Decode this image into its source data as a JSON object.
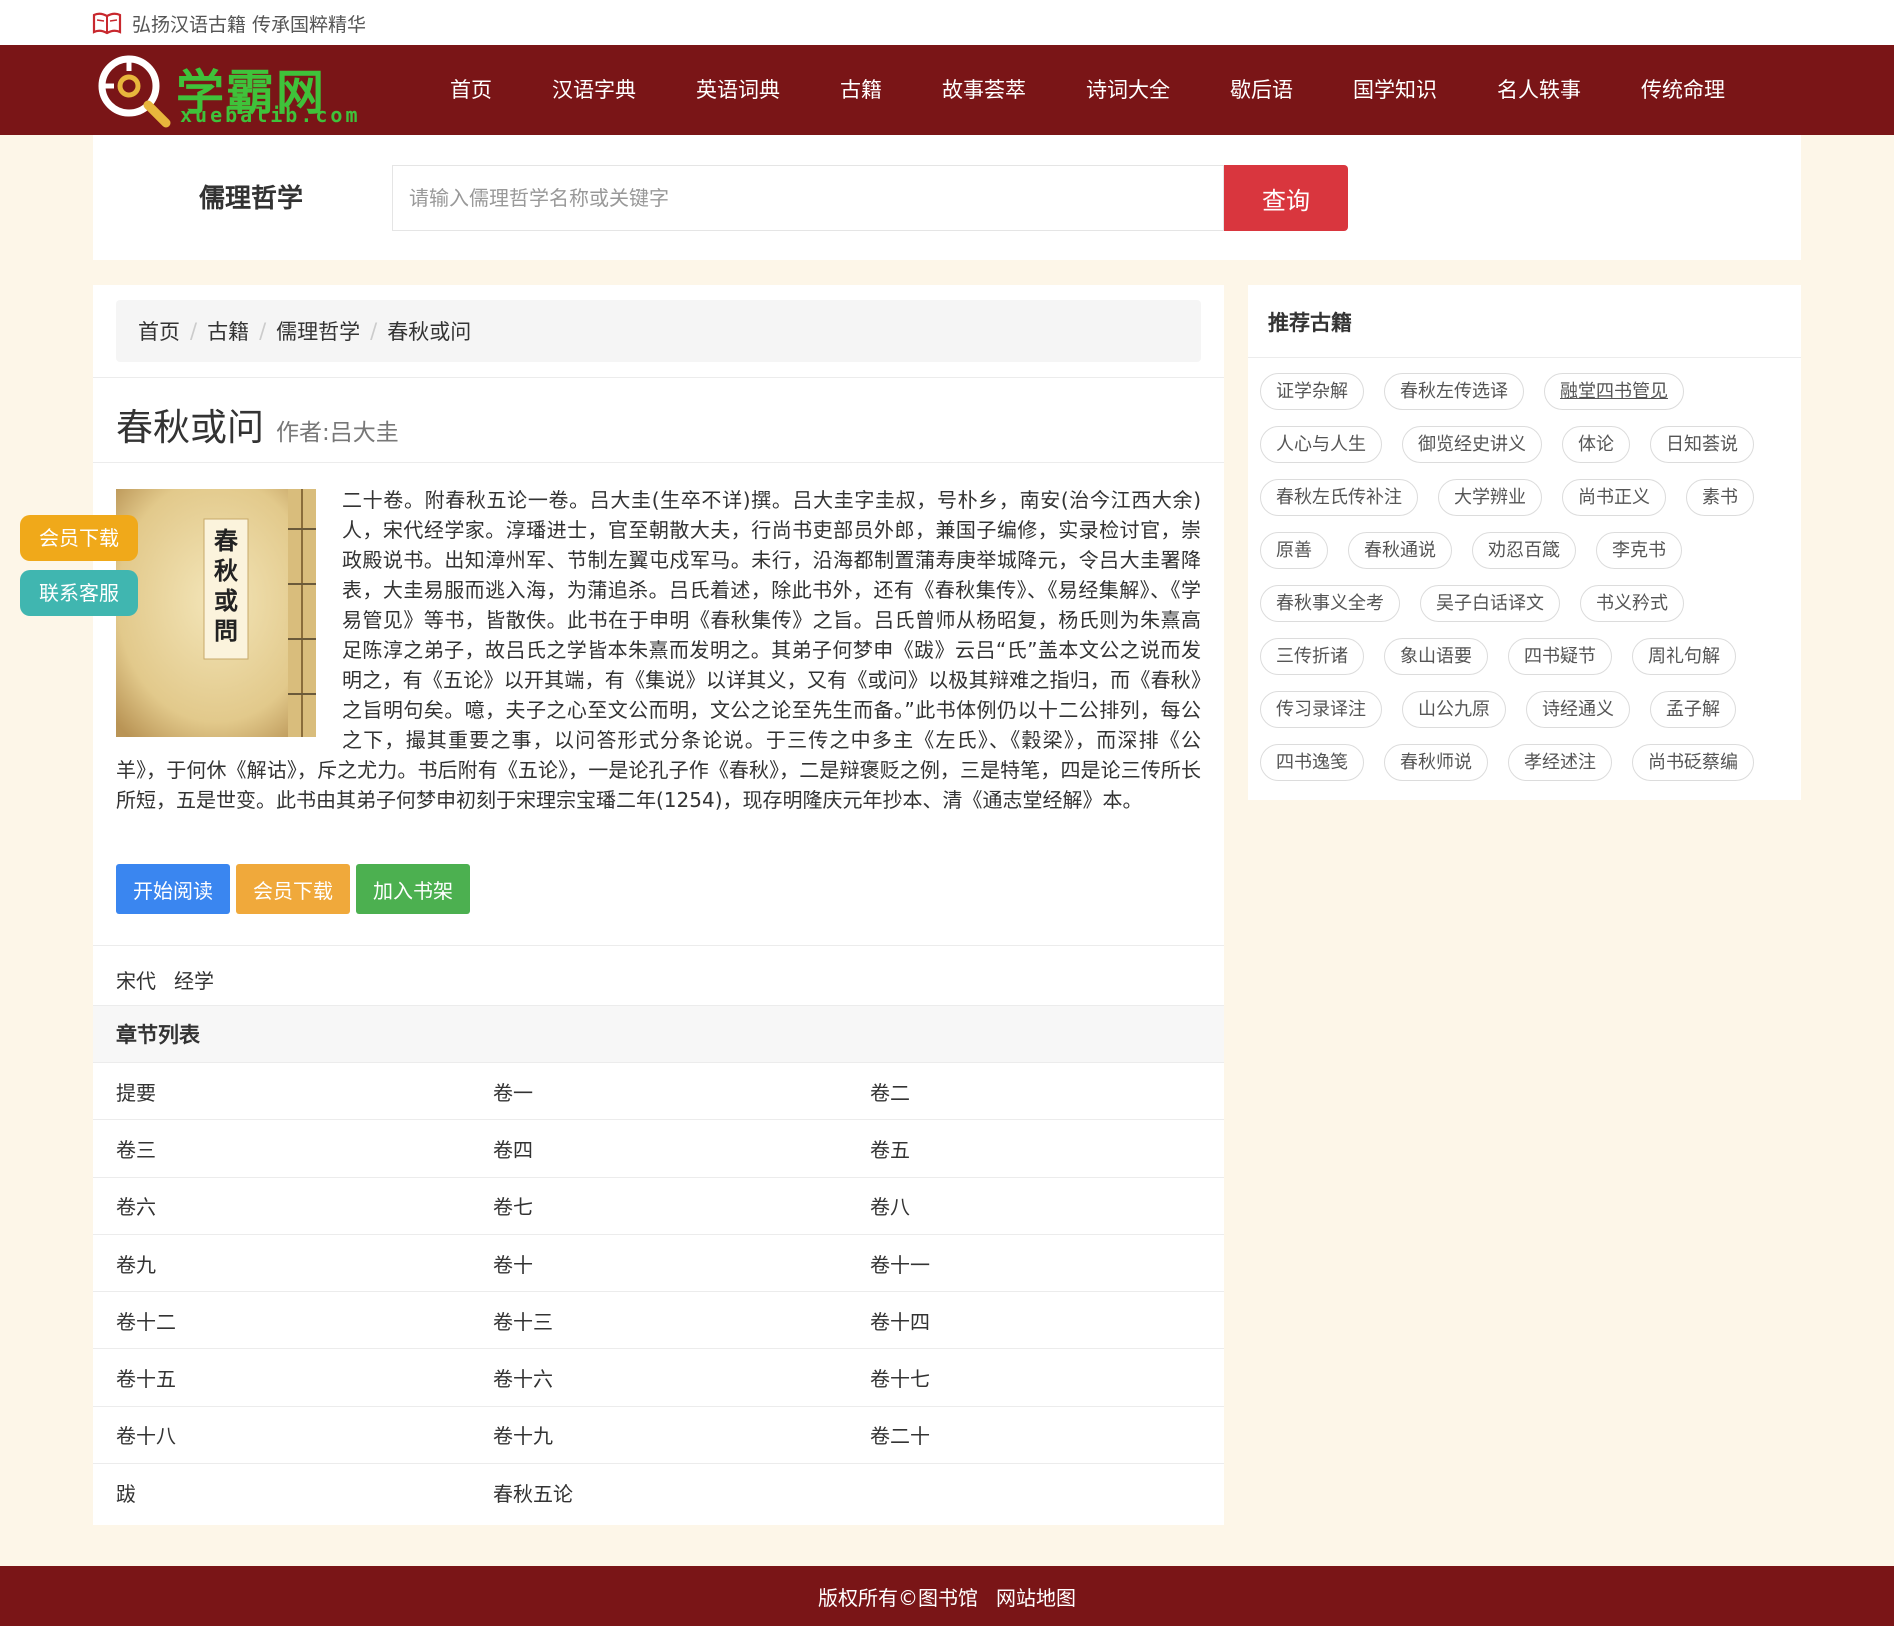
{
  "topbar": {
    "slogan": "弘扬汉语古籍 传承国粹精华",
    "icon": "book-icon"
  },
  "logo": {
    "main": "学霸网",
    "sub": "xuebalib.com"
  },
  "nav": [
    {
      "label": "首页"
    },
    {
      "label": "汉语字典"
    },
    {
      "label": "英语词典"
    },
    {
      "label": "古籍"
    },
    {
      "label": "故事荟萃"
    },
    {
      "label": "诗词大全"
    },
    {
      "label": "歇后语"
    },
    {
      "label": "国学知识"
    },
    {
      "label": "名人轶事"
    },
    {
      "label": "传统命理"
    }
  ],
  "search": {
    "title": "儒理哲学",
    "placeholder": "请输入儒理哲学名称或关键字",
    "button": "查询"
  },
  "breadcrumb": [
    "首页",
    "古籍",
    "儒理哲学",
    "春秋或问"
  ],
  "book": {
    "title": "春秋或问",
    "author": "作者:吕大圭",
    "cover_text": "春秋或問",
    "description": "二十卷。附春秋五论一卷。吕大圭(生卒不详)撰。吕大圭字圭叔，号朴乡，南安(治今江西大余)人，宋代经学家。淳璠进士，官至朝散大夫，行尚书吏部员外郎，兼国子编修，实录检讨官，崇政殿说书。出知漳州军、节制左翼屯戍军马。未行，沿海都制置蒲寿庚举城降元，令吕大圭署降表，大圭易服而逃入海，为蒲追杀。吕氏着述，除此书外，还有《春秋集传》、《易经集解》、《学易管见》等书，皆散佚。此书在于申明《春秋集传》之旨。吕氏曾师从杨昭复，杨氏则为朱熹高足陈淳之弟子，故吕氏之学皆本朱熹而发明之。其弟子何梦申《跋》云吕“氏”盖本文公之说而发明之，有《五论》以开其端，有《集说》以详其义，又有《或问》以极其辩难之指归，而《春秋》之旨明句矣。噫，夫子之心至文公而明，文公之论至先生而备。”此书体例仍以十二公排列，每公之下，撮其重要之事，以问答形式分条论说。于三传之中多主《左氏》、《穀梁》，而深排《公羊》，于何休《解诂》，斥之尤力。书后附有《五论》，一是论孔子作《春秋》，二是辩褒贬之例，三是特笔，四是论三传所长所短，五是世变。此书由其弟子何梦申初刻于宋理宗宝璠二年(1254)，现存明隆庆元年抄本、清《通志堂经解》本。",
    "buttons": {
      "read": "开始阅读",
      "download": "会员下载",
      "shelf": "加入书架"
    },
    "dynasty": "宋代",
    "category": "经学"
  },
  "chapters": {
    "heading": "章节列表",
    "items": [
      "提要",
      "卷一",
      "卷二",
      "卷三",
      "卷四",
      "卷五",
      "卷六",
      "卷七",
      "卷八",
      "卷九",
      "卷十",
      "卷十一",
      "卷十二",
      "卷十三",
      "卷十四",
      "卷十五",
      "卷十六",
      "卷十七",
      "卷十八",
      "卷十九",
      "卷二十",
      "跋",
      "春秋五论"
    ]
  },
  "sidebar": {
    "title": "推荐古籍",
    "tags": [
      "证学杂解",
      "春秋左传选译",
      "融堂四书管见",
      "人心与人生",
      "御览经史讲义",
      "体论",
      "日知荟说",
      "春秋左氏传补注",
      "大学辨业",
      "尚书正义",
      "素书",
      "原善",
      "春秋通说",
      "劝忍百箴",
      "李克书",
      "春秋事义全考",
      "吴子白话译文",
      "书义矜式",
      "三传折诸",
      "象山语要",
      "四书疑节",
      "周礼句解",
      "传习录译注",
      "山公九原",
      "诗经通义",
      "孟子解",
      "四书逸笺",
      "春秋师说",
      "孝经述注",
      "尚书砭蔡编"
    ]
  },
  "floating": {
    "vip": "会员下载",
    "service": "联系客服"
  },
  "footer": {
    "copyright": "版权所有©图书馆",
    "sitemap": "网站地图"
  },
  "colors": {
    "nav_bg": "#7a1517",
    "page_bg": "#fdf6e8",
    "search_button": "#d9363e",
    "logo_green": "#3fc23a",
    "read_button": "#3a86f0",
    "download_button": "#f0a93b",
    "shelf_button": "#4cb050",
    "service_button": "#40b6b0"
  }
}
